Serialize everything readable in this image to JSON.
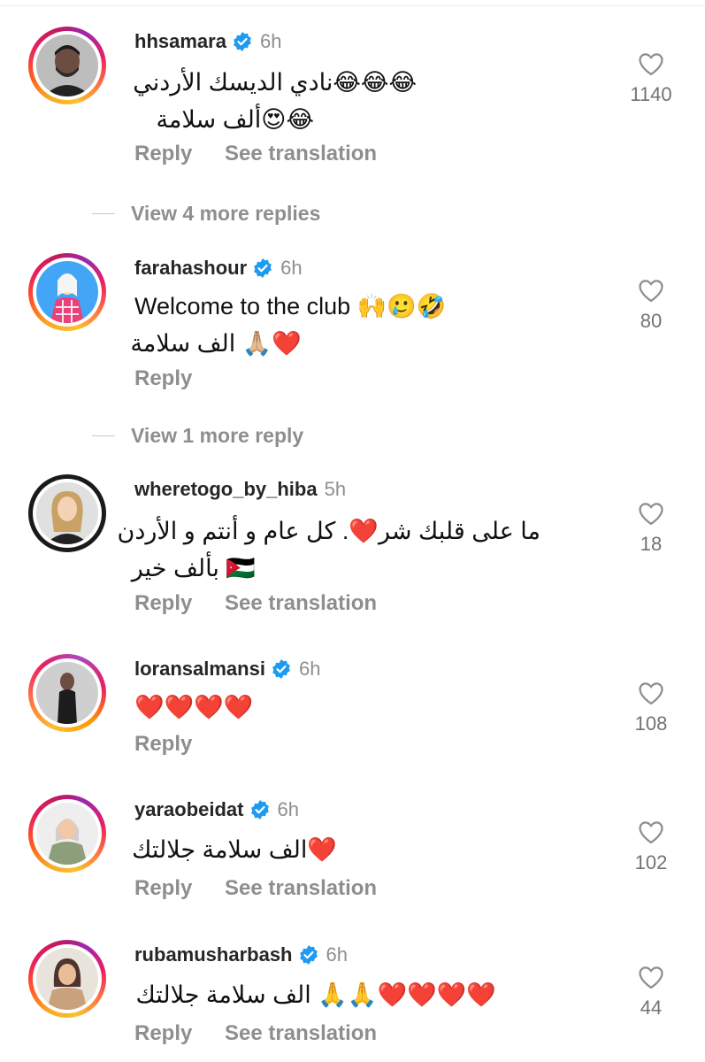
{
  "comments": [
    {
      "username": "hhsamara",
      "time": "6h",
      "lines": [
        "😂😂😂نادي الديسك الأردني",
        "😂😍ألف سلامة"
      ],
      "actions": [
        "Reply",
        "See translation"
      ],
      "likes": "1140"
    },
    {
      "username": "farahashour",
      "time": "6h",
      "lines": [
        "Welcome to the club 🙌🥲🤣",
        "❤️🙏🏼 الف سلامة"
      ],
      "actions": [
        "Reply"
      ],
      "likes": "80"
    },
    {
      "username": "wheretogo_by_hiba",
      "time": "5h",
      "lines": [
        "ما على قلبك شر❤️. كل عام و أنتم و الأردن",
        "🇯🇴 بألف خير"
      ],
      "actions": [
        "Reply",
        "See translation"
      ],
      "likes": "18"
    },
    {
      "username": "loransalmansi",
      "time": "6h",
      "lines": [
        "❤️❤️❤️❤️"
      ],
      "actions": [
        "Reply"
      ],
      "likes": "108"
    },
    {
      "username": "yaraobeidat",
      "time": "6h",
      "lines": [
        "❤️الف سلامة جلالتك"
      ],
      "actions": [
        "Reply",
        "See translation"
      ],
      "likes": "102"
    },
    {
      "username": "rubamusharbash",
      "time": "6h",
      "lines": [
        "❤️❤️❤️❤️🙏🙏 الف سلامة جلالتك"
      ],
      "actions": [
        "Reply",
        "See translation"
      ],
      "likes": "44"
    }
  ],
  "more_replies": [
    "View 4 more replies",
    "View 1 more reply"
  ],
  "colors": {
    "verified": "#1d9bf0",
    "muted": "#8e8e8e",
    "text": "#262626"
  },
  "icons": {
    "like": "heart-outline-icon",
    "verified": "verified-badge-icon"
  }
}
